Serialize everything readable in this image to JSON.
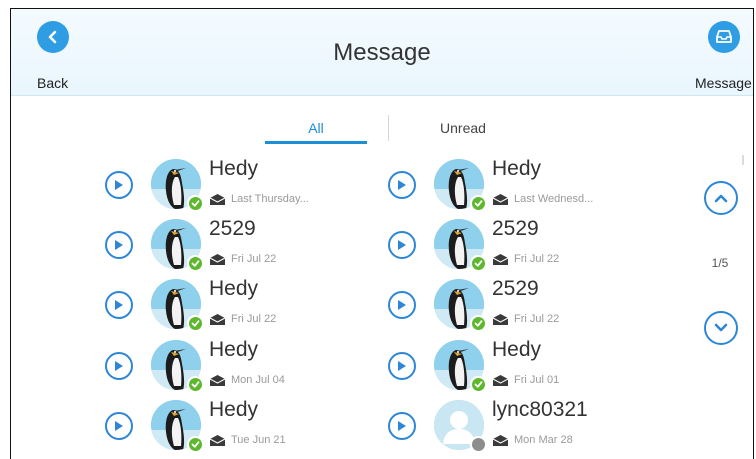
{
  "header": {
    "title": "Message",
    "back_label": "Back",
    "message_label": "Message",
    "back_icon": "chevron-left-icon",
    "message_icon": "inbox-icon"
  },
  "tabs": [
    {
      "label": "All",
      "active": true
    },
    {
      "label": "Unread",
      "active": false
    }
  ],
  "messages_left": [
    {
      "name": "Hedy",
      "date": "Last Thursday...",
      "status": "online"
    },
    {
      "name": "2529",
      "date": "Fri Jul 22",
      "status": "online"
    },
    {
      "name": "Hedy",
      "date": "Fri Jul 22",
      "status": "online"
    },
    {
      "name": "Hedy",
      "date": "Mon Jul 04",
      "status": "online"
    },
    {
      "name": "Hedy",
      "date": "Tue Jun 21",
      "status": "online"
    }
  ],
  "messages_right": [
    {
      "name": "Hedy",
      "date": "Last Wednesd...",
      "status": "online"
    },
    {
      "name": "2529",
      "date": "Fri Jul 22",
      "status": "online"
    },
    {
      "name": "2529",
      "date": "Fri Jul 22",
      "status": "online"
    },
    {
      "name": "Hedy",
      "date": "Fri Jul 01",
      "status": "online"
    },
    {
      "name": "lync80321",
      "date": "Mon Mar 28",
      "status": "offline",
      "avatar": "default-contact"
    }
  ],
  "pagination": {
    "current": 1,
    "total": 5,
    "text": "1/5"
  },
  "colors": {
    "accent": "#2e9de3",
    "play_border": "#2e86d6",
    "online": "#5db82d",
    "offline": "#8d8d8d",
    "active_tab": "#1a8fd6"
  }
}
